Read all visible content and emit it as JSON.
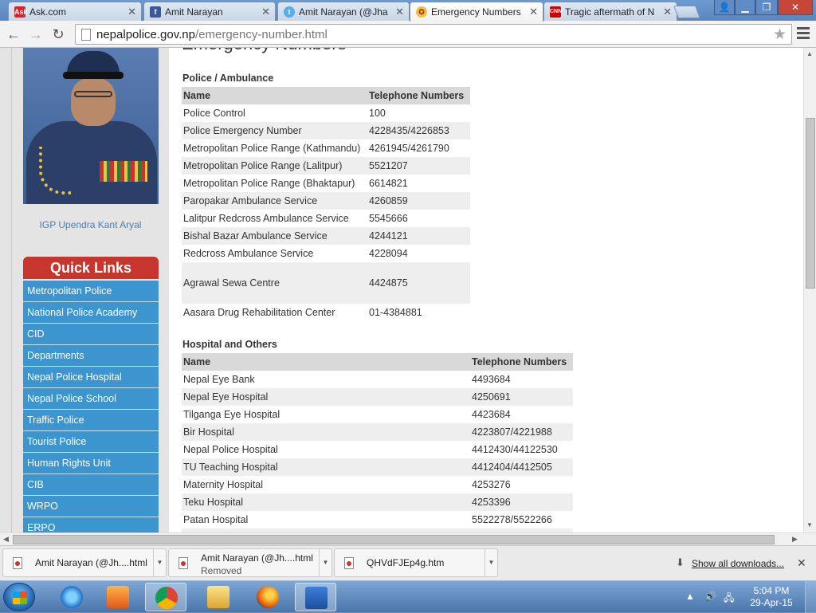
{
  "browser": {
    "tabs": [
      {
        "title": "Ask.com",
        "icon": "ask-favicon",
        "color": "#d8232a",
        "active": false
      },
      {
        "title": "Amit Narayan",
        "icon": "facebook-favicon",
        "color": "#3b5998",
        "active": false
      },
      {
        "title": "Amit Narayan (@Jha",
        "icon": "twitter-favicon",
        "color": "#55acee",
        "active": false
      },
      {
        "title": "Emergency Numbers",
        "icon": "police-favicon",
        "color": "#c8352d",
        "active": true
      },
      {
        "title": "Tragic aftermath of N",
        "icon": "cnn-favicon",
        "color": "#cc0000",
        "active": false
      }
    ],
    "url_host": "nepalpolice.gov.np",
    "url_path": "/emergency-number.html"
  },
  "page": {
    "heading": "Emergency Numbers",
    "igp_caption": "IGP Upendra Kant Aryal",
    "quick_links_title": "Quick Links",
    "quick_links": [
      "Metropolitan Police",
      "National Police Academy",
      "CID",
      "Departments",
      "Nepal Police Hospital",
      "Nepal Police School",
      "Traffic Police",
      "Tourist Police",
      "Human Rights Unit",
      "CIB",
      "WRPO",
      "ERPO"
    ],
    "police_section": {
      "title": "Police / Ambulance",
      "col_name": "Name",
      "col_phone": "Telephone Numbers",
      "rows": [
        {
          "name": "Police Control",
          "phone": "100"
        },
        {
          "name": "Police Emergency Number",
          "phone": "4228435/4226853"
        },
        {
          "name": "Metropolitan Police Range (Kathmandu)",
          "phone": "4261945/4261790"
        },
        {
          "name": "Metropolitan Police Range (Lalitpur)",
          "phone": "5521207"
        },
        {
          "name": "Metropolitan Police Range (Bhaktapur)",
          "phone": "6614821"
        },
        {
          "name": "Paropakar Ambulance Service",
          "phone": "4260859"
        },
        {
          "name": "Lalitpur Redcross Ambulance Service",
          "phone": "5545666"
        },
        {
          "name": "Bishal Bazar Ambulance Service",
          "phone": "4244121"
        },
        {
          "name": "Redcross Ambulance Service",
          "phone": "4228094"
        },
        {
          "name": "Agrawal Sewa Centre",
          "phone": "4424875"
        },
        {
          "name": "Aasara Drug Rehabilitation Center",
          "phone": "01-4384881"
        }
      ]
    },
    "hospital_section": {
      "title": "Hospital and Others",
      "col_name": "Name",
      "col_phone": "Telephone Numbers",
      "rows": [
        {
          "name": "Nepal Eye Bank",
          "phone": "4493684"
        },
        {
          "name": "Nepal Eye Hospital",
          "phone": "4250691"
        },
        {
          "name": "Tilganga Eye Hospital",
          "phone": "4423684"
        },
        {
          "name": "Bir Hospital",
          "phone": "4223807/4221988"
        },
        {
          "name": "Nepal Police Hospital",
          "phone": "4412430/44122530"
        },
        {
          "name": "TU Teaching Hospital",
          "phone": "4412404/4412505"
        },
        {
          "name": "Maternity Hospital",
          "phone": "4253276"
        },
        {
          "name": "Teku Hospital",
          "phone": "4253396"
        },
        {
          "name": "Patan Hospital",
          "phone": "5522278/5522266"
        }
      ]
    }
  },
  "downloads": {
    "items": [
      {
        "name": "Amit Narayan (@Jh....html",
        "status": ""
      },
      {
        "name": "Amit Narayan (@Jh....html",
        "status": "Removed"
      },
      {
        "name": "QHVdFJEp4g.htm",
        "status": ""
      }
    ],
    "show_all": "Show all downloads..."
  },
  "taskbar": {
    "time": "5:04 PM",
    "date": "29-Apr-15"
  }
}
